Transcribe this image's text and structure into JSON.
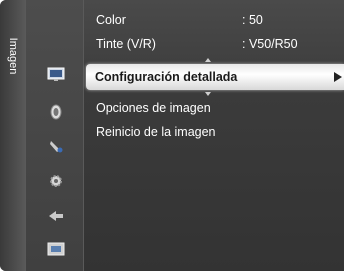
{
  "menu": {
    "category_label": "Imagen",
    "icons": [
      "picture-icon",
      "sound-icon",
      "channel-icon",
      "setup-icon",
      "input-icon",
      "application-icon"
    ],
    "rows": [
      {
        "label": "Color",
        "value": ": 50"
      },
      {
        "label": "Tinte (V/R)",
        "value": ": V50/R50"
      }
    ],
    "selected": {
      "label": "Configuración detallada"
    },
    "items": [
      {
        "label": "Opciones de imagen"
      },
      {
        "label": "Reinicio de la imagen"
      }
    ]
  }
}
